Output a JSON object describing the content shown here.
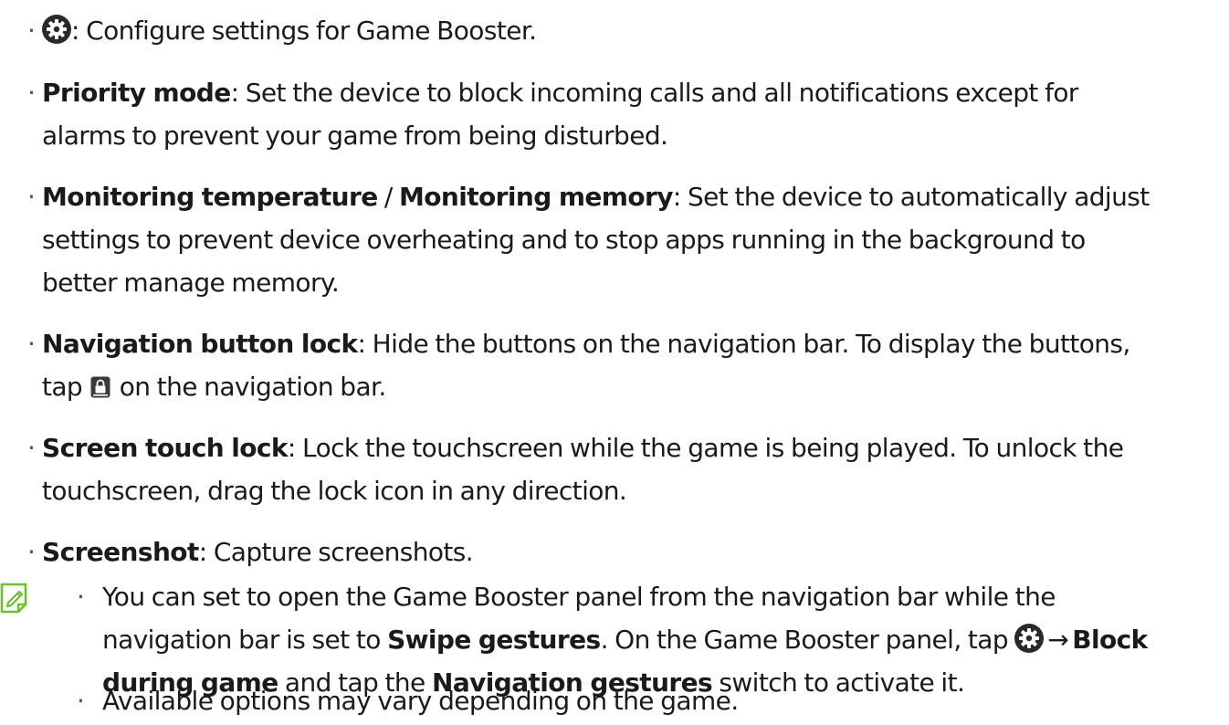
{
  "items": [
    {
      "id": "settings",
      "icon": "gear-icon",
      "text": ": Configure settings for Game Booster."
    },
    {
      "id": "priority-mode",
      "term": "Priority mode",
      "lines": [
        ": Set the device to block incoming calls and all notifications except for",
        "alarms to prevent your game from being disturbed."
      ]
    },
    {
      "id": "monitoring",
      "term_a": "Monitoring temperature",
      "separator": " / ",
      "term_b": "Monitoring memory",
      "lines": [
        ": Set the device to automatically adjust",
        "settings to prevent device overheating and to stop apps running in the background to",
        "better manage memory."
      ]
    },
    {
      "id": "navigation-button-lock",
      "term": "Navigation button lock",
      "line1": ": Hide the buttons on the navigation bar. To display the buttons,",
      "line2_before": "tap",
      "line2_icon": "lock-icon",
      "line2_after": "on the navigation bar."
    },
    {
      "id": "screen-touch-lock",
      "term": "Screen touch lock",
      "lines": [
        ": Lock the touchscreen while the game is being played. To unlock the",
        "touchscreen, drag the lock icon in any direction."
      ]
    },
    {
      "id": "screenshot",
      "term": "Screenshot",
      "text": ": Capture screenshots."
    }
  ],
  "note": {
    "icon": "note-pencil-icon",
    "color": "#6cbf2f",
    "items": [
      {
        "line1": "You can set to open the Game Booster panel from the navigation bar while the",
        "line2_before": "navigation bar is set to",
        "line2_term": "Swipe gestures",
        "line2_mid": ". On the Game Booster panel, tap",
        "line2_arrow": "→",
        "line2_term2": "Block",
        "line3_term": "during game",
        "line3_mid": " and tap the",
        "line3_term2": "Navigation gestures",
        "line3_after": " switch to activate it."
      },
      {
        "text": "Available options may vary depending on the game."
      }
    ]
  },
  "bullet_char": "·"
}
